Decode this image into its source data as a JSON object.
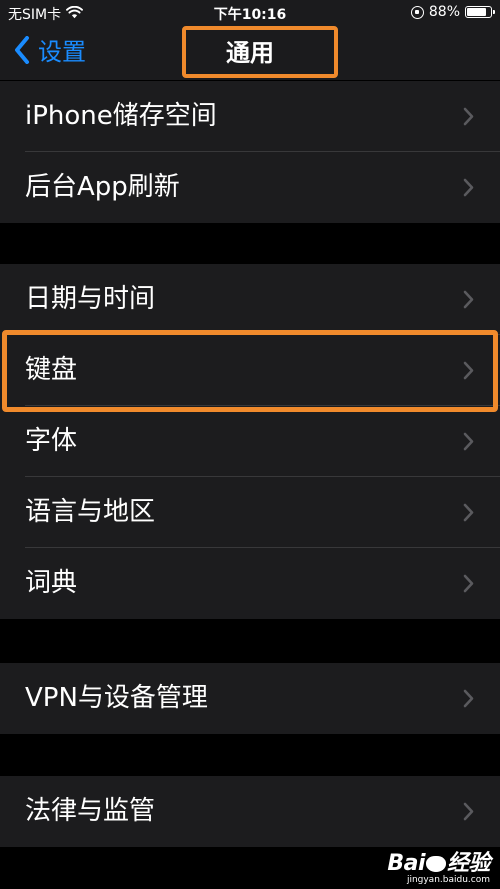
{
  "status_bar": {
    "carrier": "无SIM卡",
    "time": "下午10:16",
    "battery_text": "88%",
    "battery_level": 0.88
  },
  "nav": {
    "back_label": "设置",
    "title": "通用"
  },
  "groups": [
    [
      "iPhone储存空间",
      "后台App刷新"
    ],
    [
      "日期与时间",
      "键盘",
      "字体",
      "语言与地区",
      "词典"
    ],
    [
      "VPN与设备管理"
    ],
    [
      "法律与监管"
    ]
  ],
  "highlight": {
    "color": "#f08a2c",
    "targets": [
      "nav-title",
      "row-keyboard"
    ]
  },
  "accent_color": "#1a8cff",
  "watermark": {
    "logo_left": "Bai",
    "logo_right": "经验",
    "url": "jingyan.baidu.com"
  }
}
